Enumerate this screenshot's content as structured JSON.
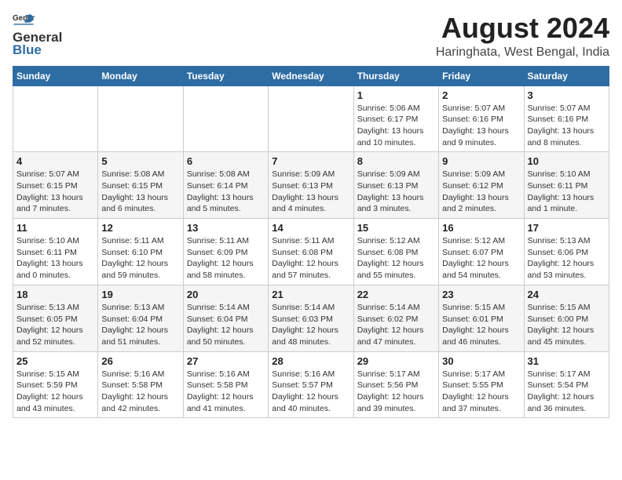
{
  "header": {
    "logo_general": "General",
    "logo_blue": "Blue",
    "month_title": "August 2024",
    "subtitle": "Haringhata, West Bengal, India"
  },
  "calendar": {
    "days_of_week": [
      "Sunday",
      "Monday",
      "Tuesday",
      "Wednesday",
      "Thursday",
      "Friday",
      "Saturday"
    ],
    "weeks": [
      [
        {
          "day": "",
          "info": ""
        },
        {
          "day": "",
          "info": ""
        },
        {
          "day": "",
          "info": ""
        },
        {
          "day": "",
          "info": ""
        },
        {
          "day": "1",
          "info": "Sunrise: 5:06 AM\nSunset: 6:17 PM\nDaylight: 13 hours\nand 10 minutes."
        },
        {
          "day": "2",
          "info": "Sunrise: 5:07 AM\nSunset: 6:16 PM\nDaylight: 13 hours\nand 9 minutes."
        },
        {
          "day": "3",
          "info": "Sunrise: 5:07 AM\nSunset: 6:16 PM\nDaylight: 13 hours\nand 8 minutes."
        }
      ],
      [
        {
          "day": "4",
          "info": "Sunrise: 5:07 AM\nSunset: 6:15 PM\nDaylight: 13 hours\nand 7 minutes."
        },
        {
          "day": "5",
          "info": "Sunrise: 5:08 AM\nSunset: 6:15 PM\nDaylight: 13 hours\nand 6 minutes."
        },
        {
          "day": "6",
          "info": "Sunrise: 5:08 AM\nSunset: 6:14 PM\nDaylight: 13 hours\nand 5 minutes."
        },
        {
          "day": "7",
          "info": "Sunrise: 5:09 AM\nSunset: 6:13 PM\nDaylight: 13 hours\nand 4 minutes."
        },
        {
          "day": "8",
          "info": "Sunrise: 5:09 AM\nSunset: 6:13 PM\nDaylight: 13 hours\nand 3 minutes."
        },
        {
          "day": "9",
          "info": "Sunrise: 5:09 AM\nSunset: 6:12 PM\nDaylight: 13 hours\nand 2 minutes."
        },
        {
          "day": "10",
          "info": "Sunrise: 5:10 AM\nSunset: 6:11 PM\nDaylight: 13 hours\nand 1 minute."
        }
      ],
      [
        {
          "day": "11",
          "info": "Sunrise: 5:10 AM\nSunset: 6:11 PM\nDaylight: 13 hours\nand 0 minutes."
        },
        {
          "day": "12",
          "info": "Sunrise: 5:11 AM\nSunset: 6:10 PM\nDaylight: 12 hours\nand 59 minutes."
        },
        {
          "day": "13",
          "info": "Sunrise: 5:11 AM\nSunset: 6:09 PM\nDaylight: 12 hours\nand 58 minutes."
        },
        {
          "day": "14",
          "info": "Sunrise: 5:11 AM\nSunset: 6:08 PM\nDaylight: 12 hours\nand 57 minutes."
        },
        {
          "day": "15",
          "info": "Sunrise: 5:12 AM\nSunset: 6:08 PM\nDaylight: 12 hours\nand 55 minutes."
        },
        {
          "day": "16",
          "info": "Sunrise: 5:12 AM\nSunset: 6:07 PM\nDaylight: 12 hours\nand 54 minutes."
        },
        {
          "day": "17",
          "info": "Sunrise: 5:13 AM\nSunset: 6:06 PM\nDaylight: 12 hours\nand 53 minutes."
        }
      ],
      [
        {
          "day": "18",
          "info": "Sunrise: 5:13 AM\nSunset: 6:05 PM\nDaylight: 12 hours\nand 52 minutes."
        },
        {
          "day": "19",
          "info": "Sunrise: 5:13 AM\nSunset: 6:04 PM\nDaylight: 12 hours\nand 51 minutes."
        },
        {
          "day": "20",
          "info": "Sunrise: 5:14 AM\nSunset: 6:04 PM\nDaylight: 12 hours\nand 50 minutes."
        },
        {
          "day": "21",
          "info": "Sunrise: 5:14 AM\nSunset: 6:03 PM\nDaylight: 12 hours\nand 48 minutes."
        },
        {
          "day": "22",
          "info": "Sunrise: 5:14 AM\nSunset: 6:02 PM\nDaylight: 12 hours\nand 47 minutes."
        },
        {
          "day": "23",
          "info": "Sunrise: 5:15 AM\nSunset: 6:01 PM\nDaylight: 12 hours\nand 46 minutes."
        },
        {
          "day": "24",
          "info": "Sunrise: 5:15 AM\nSunset: 6:00 PM\nDaylight: 12 hours\nand 45 minutes."
        }
      ],
      [
        {
          "day": "25",
          "info": "Sunrise: 5:15 AM\nSunset: 5:59 PM\nDaylight: 12 hours\nand 43 minutes."
        },
        {
          "day": "26",
          "info": "Sunrise: 5:16 AM\nSunset: 5:58 PM\nDaylight: 12 hours\nand 42 minutes."
        },
        {
          "day": "27",
          "info": "Sunrise: 5:16 AM\nSunset: 5:58 PM\nDaylight: 12 hours\nand 41 minutes."
        },
        {
          "day": "28",
          "info": "Sunrise: 5:16 AM\nSunset: 5:57 PM\nDaylight: 12 hours\nand 40 minutes."
        },
        {
          "day": "29",
          "info": "Sunrise: 5:17 AM\nSunset: 5:56 PM\nDaylight: 12 hours\nand 39 minutes."
        },
        {
          "day": "30",
          "info": "Sunrise: 5:17 AM\nSunset: 5:55 PM\nDaylight: 12 hours\nand 37 minutes."
        },
        {
          "day": "31",
          "info": "Sunrise: 5:17 AM\nSunset: 5:54 PM\nDaylight: 12 hours\nand 36 minutes."
        }
      ]
    ]
  }
}
